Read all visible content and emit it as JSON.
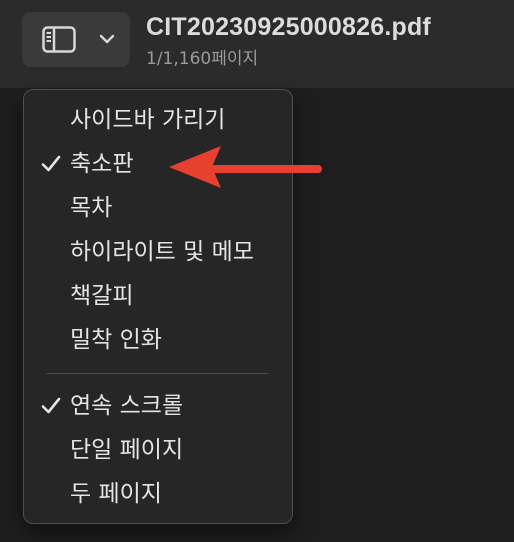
{
  "toolbar": {
    "sidebar_button_icon": "sidebar-icon",
    "chevron_icon": "chevron-down-icon",
    "title": "CIT20230925000826.pdf",
    "subtitle": "1/1,160페이지"
  },
  "menu": {
    "group1": [
      {
        "label": "사이드바 가리기",
        "checked": false
      },
      {
        "label": "축소판",
        "checked": true
      },
      {
        "label": "목차",
        "checked": false
      },
      {
        "label": "하이라이트 및 메모",
        "checked": false
      },
      {
        "label": "책갈피",
        "checked": false
      },
      {
        "label": "밀착 인화",
        "checked": false
      }
    ],
    "group2": [
      {
        "label": "연속 스크롤",
        "checked": true
      },
      {
        "label": "단일 페이지",
        "checked": false
      },
      {
        "label": "두 페이지",
        "checked": false
      }
    ]
  },
  "annotation": {
    "arrow_color": "#e8402e",
    "points_to": "축소판"
  },
  "colors": {
    "background": "#1e1e1e",
    "toolbar": "#2b2b2b",
    "menu": "#262626",
    "text": "#e4e4e4"
  }
}
